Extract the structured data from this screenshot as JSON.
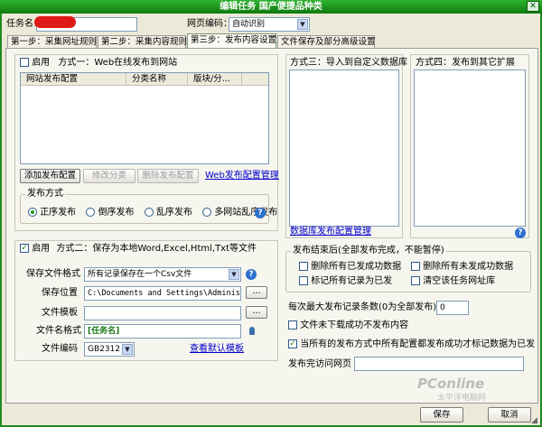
{
  "window": {
    "title": "编辑任务 国产便捷品种类",
    "close": "✕"
  },
  "task": {
    "name_label": "任务名：",
    "name_value": ""
  },
  "publish": {
    "label": "网页编码：",
    "value": "自动识别"
  },
  "tabs": [
    {
      "label": "第一步：采集网址规则"
    },
    {
      "label": "第二步：采集内容规则"
    },
    {
      "label": "第三步：发布内容设置"
    },
    {
      "label": "文件保存及部分高级设置"
    }
  ],
  "method1": {
    "enable_label": "启用",
    "title": "方式一：Web在线发布到网站",
    "columns": [
      "网站发布配置",
      "分类名称",
      "版块/分..."
    ],
    "buttons": {
      "add": "添加发布配置",
      "modify": "修改分类",
      "delete": "删除发布配置"
    },
    "manage_link": "Web发布配置管理",
    "mode_group": "发布方式",
    "modes": [
      "正序发布",
      "倒序发布",
      "乱序发布",
      "多网站乱序发布"
    ]
  },
  "method3": {
    "title": "方式三：导入到自定义数据库",
    "link": "数据库发布配置管理"
  },
  "method4": {
    "title": "方式四：发布到其它扩展"
  },
  "method2": {
    "enable_label": "启用",
    "title": "方式二：保存为本地Word,Excel,Html,Txt等文件",
    "format_label": "保存文件格式",
    "format_value": "所有记录保存在一个Csv文件",
    "location_label": "保存位置",
    "location_value": "C:\\Documents and Settings\\Administrat",
    "template_label": "文件模板",
    "template_value": "",
    "filename_label": "文件名格式",
    "filename_value": "[任务名]",
    "encoding_label": "文件编码",
    "encoding_value": "GB2312",
    "default_template_link": "查看默认模板",
    "browse": "..."
  },
  "after_publish": {
    "group_title": "发布结束后(全部发布完成，不能暂停)",
    "options": [
      "删除所有已发成功数据",
      "删除所有未发成功数据",
      "标记所有记录为已发",
      "清空该任务网址库"
    ]
  },
  "max_records": {
    "label": "每次最大发布记录条数(0为全部发布)：",
    "value": "0"
  },
  "unpublished_content": {
    "label": "文件未下载成功不发布内容"
  },
  "mark_published": {
    "label": "当所有的发布方式中所有配置都发布成功才标记数据为已发"
  },
  "visit_url": {
    "label": "发布完访问网页",
    "value": ""
  },
  "footer": {
    "save": "保存",
    "cancel": "取消"
  },
  "watermark": {
    "brand": "PConline",
    "sub": "太平洋电脑网"
  },
  "colors": {
    "frame": "#1f8a1f",
    "client": "#ece9d8",
    "link": "#0000cc",
    "accent_check": "#1a7a1a"
  },
  "icons": [
    "help-icon",
    "pin-icon",
    "resize-icon",
    "dropdown-arrow-icon"
  ]
}
